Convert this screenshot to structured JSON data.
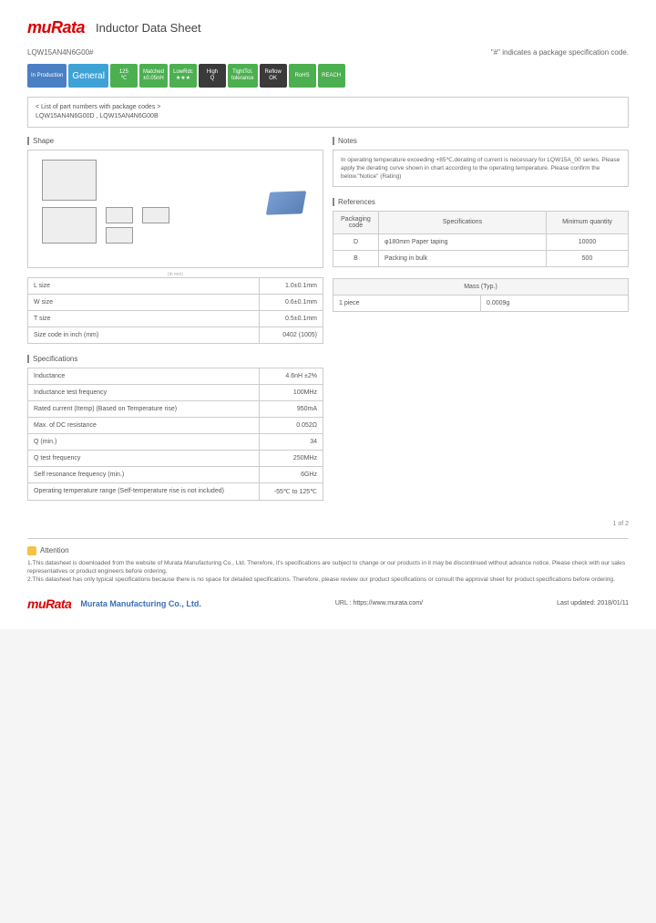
{
  "header": {
    "logo": "muRata",
    "title": "Inductor Data Sheet"
  },
  "partNumber": "LQW15AN4N6G00#",
  "noteIndicator": "\"#\" indicates a package specification code.",
  "badges": {
    "prod": "In Production",
    "gen": "General",
    "t125": "125",
    "t125sub": "℃",
    "matched": "Matched",
    "matchedSub": "±0.05nH",
    "lowrdc": "LowRdc",
    "lowrdcSub": "★★★",
    "highq": "High",
    "highqSub": "Q",
    "tight": "TightTol.",
    "tightSub": "tolerance",
    "reflow": "Reflow",
    "reflowSub": "OK",
    "rohs": "RoHS",
    "reach": "REACH"
  },
  "partList": {
    "heading": "< List of part numbers with package codes >",
    "items": "LQW15AN4N6G00D , LQW15AN4N6G00B"
  },
  "sections": {
    "shape": "Shape",
    "specs": "Specifications",
    "notes": "Notes",
    "refs": "References",
    "mass": "Mass (Typ.)"
  },
  "shapeTable": [
    {
      "k": "L size",
      "v": "1.0±0.1mm"
    },
    {
      "k": "W size",
      "v": "0.6±0.1mm"
    },
    {
      "k": "T size",
      "v": "0.5±0.1mm"
    },
    {
      "k": "Size code in inch (mm)",
      "v": "0402 (1005)"
    }
  ],
  "shapeCaption": "(in mm)",
  "specTable": [
    {
      "k": "Inductance",
      "v": "4.6nH ±2%"
    },
    {
      "k": "Inductance test frequency",
      "v": "100MHz"
    },
    {
      "k": "Rated current (Itemp) (Based on Temperature rise)",
      "v": "950mA"
    },
    {
      "k": "Max. of DC resistance",
      "v": "0.052Ω"
    },
    {
      "k": "Q (min.)",
      "v": "34"
    },
    {
      "k": "Q test frequency",
      "v": "250MHz"
    },
    {
      "k": "Self resonance frequency (min.)",
      "v": "6GHz"
    },
    {
      "k": "Operating temperature range (Self-temperature rise is not included)",
      "v": "-55℃ to 125℃"
    }
  ],
  "notesBox": "In operating temperature exceeding +85℃,derating of current is necessary for LQW15A_00 series.\nPlease apply the derating curve shown in chart according to the operating temperature.\nPlease confirm the below.\"Notice\" (Rating)",
  "refTable": {
    "headers": [
      "Packaging code",
      "Specifications",
      "Minimum quantity"
    ],
    "rows": [
      {
        "c": "D",
        "s": "φ180mm Paper taping",
        "q": "10000"
      },
      {
        "c": "B",
        "s": "Packing in bulk",
        "q": "500"
      }
    ]
  },
  "massTable": {
    "k": "1 piece",
    "v": "0.0009g"
  },
  "pageNum": "1 of 2",
  "attention": {
    "label": "Attention",
    "text1": "1.This datasheet is downloaded from the website of Murata Manufacturing Co., Ltd. Therefore, it's specifications are subject to change or our products in it may be discontinued without advance notice. Please check with our sales representatives or product engineers before ordering.",
    "text2": "2.This datasheet has only typical specifications because there is no space for detailed specifications.\nTherefore, please review our product specifications or consult the approval sheet for product specifications before ordering."
  },
  "footer": {
    "company": "Murata Manufacturing Co., Ltd.",
    "url": "URL : https://www.murata.com/",
    "updated": "Last updated: 2018/01/11"
  }
}
